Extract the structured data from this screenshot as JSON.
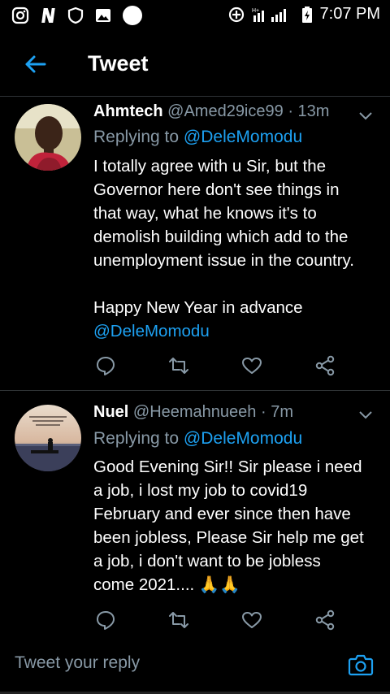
{
  "status_bar": {
    "time": "7:07 PM",
    "left_icons": [
      "instagram-icon",
      "netflix-icon",
      "shield-icon",
      "gallery-icon",
      "circle-icon"
    ],
    "right_icons": [
      "data-saver-icon",
      "signal-icon",
      "battery-icon"
    ]
  },
  "header": {
    "title": "Tweet",
    "accent": "#1da1f2"
  },
  "tweets": [
    {
      "name": "Ahmtech",
      "handle": "@Amed29ice99",
      "separator": "·",
      "time": "13m",
      "replying_prefix": "Replying to",
      "replying_handle": "@DeleMomodu",
      "body_lines": [
        "I totally agree with u Sir, but the",
        "Governor here don't see things in",
        "that way, what he knows it's to",
        "demolish building which add to the",
        "unemployment issue in the country."
      ],
      "body_line2": "Happy New Year in advance",
      "body_mention": "@DeleMomodu"
    },
    {
      "name": "Nuel",
      "handle": "@Heemahnueeh",
      "separator": "·",
      "time": "7m",
      "replying_prefix": "Replying to",
      "replying_handle": "@DeleMomodu",
      "body_lines": [
        "Good Evening Sir!! Sir please i need",
        "a job, i lost my job to covid19",
        "February and ever since then have",
        "been jobless, Please Sir help me get",
        "a job, i don't want to be jobless",
        "come 2021.... 🙏🙏"
      ]
    }
  ],
  "reply_bar": {
    "placeholder": "Tweet your reply"
  },
  "colors": {
    "background": "#000000",
    "secondary_text": "#8899a6",
    "link": "#1da1f2",
    "divider": "#2f3336"
  }
}
